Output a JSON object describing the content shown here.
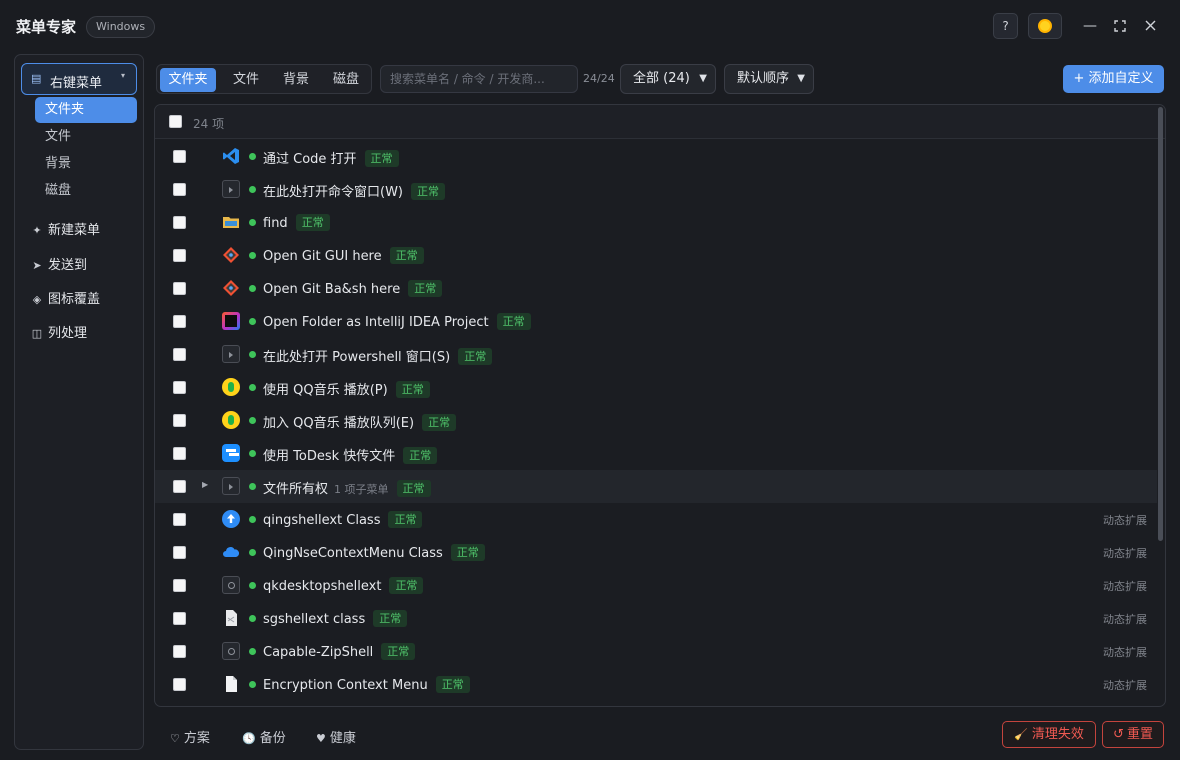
{
  "window": {
    "title": "菜单专家",
    "os_badge": "Windows",
    "help_label": "?"
  },
  "sidebar": {
    "main": {
      "label": "右键菜单",
      "icon": "list-icon"
    },
    "sub_items": [
      {
        "label": "文件夹",
        "active": true
      },
      {
        "label": "文件",
        "active": false
      },
      {
        "label": "背景",
        "active": false
      },
      {
        "label": "磁盘",
        "active": false
      }
    ],
    "items": [
      {
        "label": "新建菜单",
        "icon": "sparkle-icon"
      },
      {
        "label": "发送到",
        "icon": "send-icon"
      },
      {
        "label": "图标覆盖",
        "icon": "diamond-icon"
      },
      {
        "label": "列处理",
        "icon": "columns-icon"
      }
    ]
  },
  "toolbar": {
    "tabs": [
      {
        "label": "文件夹",
        "active": true
      },
      {
        "label": "文件",
        "active": false
      },
      {
        "label": "背景",
        "active": false
      },
      {
        "label": "磁盘",
        "active": false
      }
    ],
    "search_placeholder": "搜索菜单名 / 命令 / 开发商...",
    "count": "24/24",
    "filter_value": "全部 (24)",
    "sort_value": "默认顺序",
    "add_button": "+ 添加自定义"
  },
  "list": {
    "header_count": "24 项",
    "status_label": "正常",
    "rows": [
      {
        "name": "通过 Code 打开",
        "icon": "vscode-icon",
        "note": "",
        "tag": "",
        "expandable": false
      },
      {
        "name": "在此处打开命令窗口(W)",
        "icon": "terminal-icon",
        "note": "",
        "tag": "",
        "expandable": false
      },
      {
        "name": "find",
        "icon": "folder-icon",
        "note": "",
        "tag": "",
        "expandable": false
      },
      {
        "name": "Open Git GUI here",
        "icon": "git-icon",
        "note": "",
        "tag": "",
        "expandable": false
      },
      {
        "name": "Open Git Ba&sh here",
        "icon": "git-icon",
        "note": "",
        "tag": "",
        "expandable": false
      },
      {
        "name": "Open Folder as IntelliJ IDEA Project",
        "icon": "intellij-icon",
        "note": "",
        "tag": "",
        "expandable": false
      },
      {
        "name": "在此处打开 Powershell 窗口(S)",
        "icon": "terminal-icon",
        "note": "",
        "tag": "",
        "expandable": false
      },
      {
        "name": "使用 QQ音乐 播放(P)",
        "icon": "qqmusic-icon",
        "note": "",
        "tag": "",
        "expandable": false
      },
      {
        "name": "加入 QQ音乐 播放队列(E)",
        "icon": "qqmusic-icon",
        "note": "",
        "tag": "",
        "expandable": false
      },
      {
        "name": "使用 ToDesk 快传文件",
        "icon": "todesk-icon",
        "note": "",
        "tag": "",
        "expandable": false
      },
      {
        "name": "文件所有权",
        "icon": "terminal-icon",
        "note": "1 项子菜单",
        "tag": "",
        "expandable": true
      },
      {
        "name": "qingshellext Class",
        "icon": "upload-cloud-icon",
        "note": "",
        "tag": "动态扩展",
        "expandable": false
      },
      {
        "name": "QingNseContextMenu Class",
        "icon": "cloud-icon",
        "note": "",
        "tag": "动态扩展",
        "expandable": false
      },
      {
        "name": "qkdesktopshellext",
        "icon": "gear-icon",
        "note": "",
        "tag": "动态扩展",
        "expandable": false
      },
      {
        "name": "sgshellext class",
        "icon": "document-icon",
        "note": "",
        "tag": "动态扩展",
        "expandable": false
      },
      {
        "name": "Capable-ZipShell",
        "icon": "gear-icon",
        "note": "",
        "tag": "动态扩展",
        "expandable": false
      },
      {
        "name": "Encryption Context Menu",
        "icon": "document-icon",
        "note": "",
        "tag": "动态扩展",
        "expandable": false
      }
    ]
  },
  "footer": {
    "items": [
      {
        "label": "方案",
        "icon": "shield-icon"
      },
      {
        "label": "备份",
        "icon": "clock-icon"
      },
      {
        "label": "健康",
        "icon": "heart-icon"
      }
    ],
    "clean_button": "清理失效",
    "reset_button": "重置"
  }
}
